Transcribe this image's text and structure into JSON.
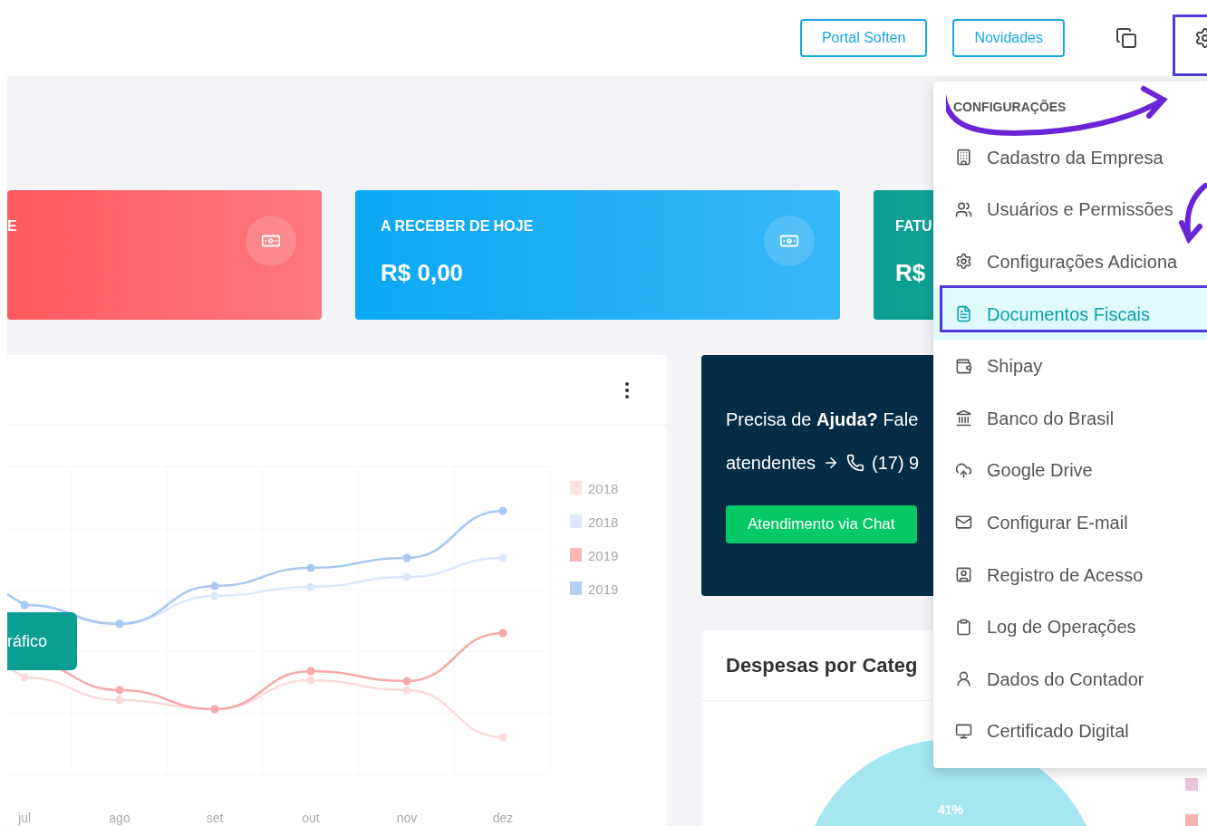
{
  "header": {
    "buttons": [
      "Portal Soften",
      "Novidades"
    ]
  },
  "cards": [
    {
      "title": "E",
      "color": "#ff5a5f"
    },
    {
      "title": "A RECEBER DE HOJE",
      "value": "R$ 0,00",
      "color": "#0aa8f5"
    },
    {
      "title": "FATU",
      "value": "R$",
      "color": "#0a9e93"
    }
  ],
  "chart_panel": {
    "x_labels": [
      "jul",
      "ago",
      "set",
      "out",
      "nov",
      "dez"
    ],
    "legend": [
      {
        "label": "2018",
        "color": "#fde2e2"
      },
      {
        "label": "2018",
        "color": "#dde9fb"
      },
      {
        "label": "2019",
        "color": "#f9b7b7"
      },
      {
        "label": "2019",
        "color": "#b5cff3"
      }
    ],
    "floating_button": "ráfico"
  },
  "help": {
    "line1": "Precisa de **Ajuda?** Fale",
    "line2": "atendentes",
    "phone": "(17) 9",
    "button": "Atendimento via Chat"
  },
  "expenses": {
    "title": "Despesas por Categ",
    "pie_label": "41%",
    "legend_swatches": [
      {
        "color": "#e9c6dc"
      },
      {
        "color": "#f7b3ad"
      }
    ]
  },
  "menu": {
    "heading": "CONFIGURAÇÕES",
    "items": [
      {
        "label": "Cadastro da Empresa",
        "selected": false
      },
      {
        "label": "Usuários e Permissões",
        "selected": false
      },
      {
        "label": "Configurações Adiciona",
        "selected": false
      },
      {
        "label": "Documentos Fiscais",
        "selected": true
      },
      {
        "label": "Shipay",
        "selected": false
      },
      {
        "label": "Banco do Brasil",
        "selected": false
      },
      {
        "label": "Google Drive",
        "selected": false
      },
      {
        "label": "Configurar E-mail",
        "selected": false
      },
      {
        "label": "Registro de Acesso",
        "selected": false
      },
      {
        "label": "Log de Operações",
        "selected": false
      },
      {
        "label": "Dados do Contador",
        "selected": false
      },
      {
        "label": "Certificado Digital",
        "selected": false
      }
    ]
  }
}
